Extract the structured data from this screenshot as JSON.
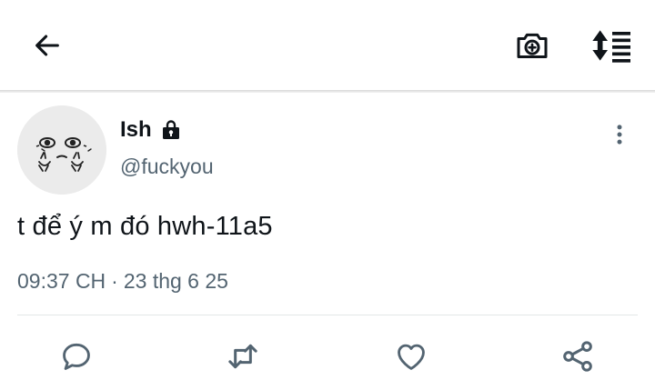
{
  "header": {
    "back_icon": "arrow-left-icon",
    "camera_icon": "camera-plus-icon",
    "sort_icon": "sort-lines-icon"
  },
  "tweet": {
    "display_name": "Ish",
    "lock_icon": "lock-icon",
    "handle": "@fuckyou",
    "text": "t để ý m đó hwh-11a5",
    "time": "09:37 CH",
    "dot": "·",
    "date": "23 thg 6 25",
    "more_icon": "more-vertical-icon"
  },
  "actions": [
    "reply-icon",
    "retweet-icon",
    "like-icon",
    "share-icon"
  ],
  "colors": {
    "text": "#0f1419",
    "secondary": "#536471",
    "icon": "#536471",
    "divider": "#e3e6e8"
  }
}
